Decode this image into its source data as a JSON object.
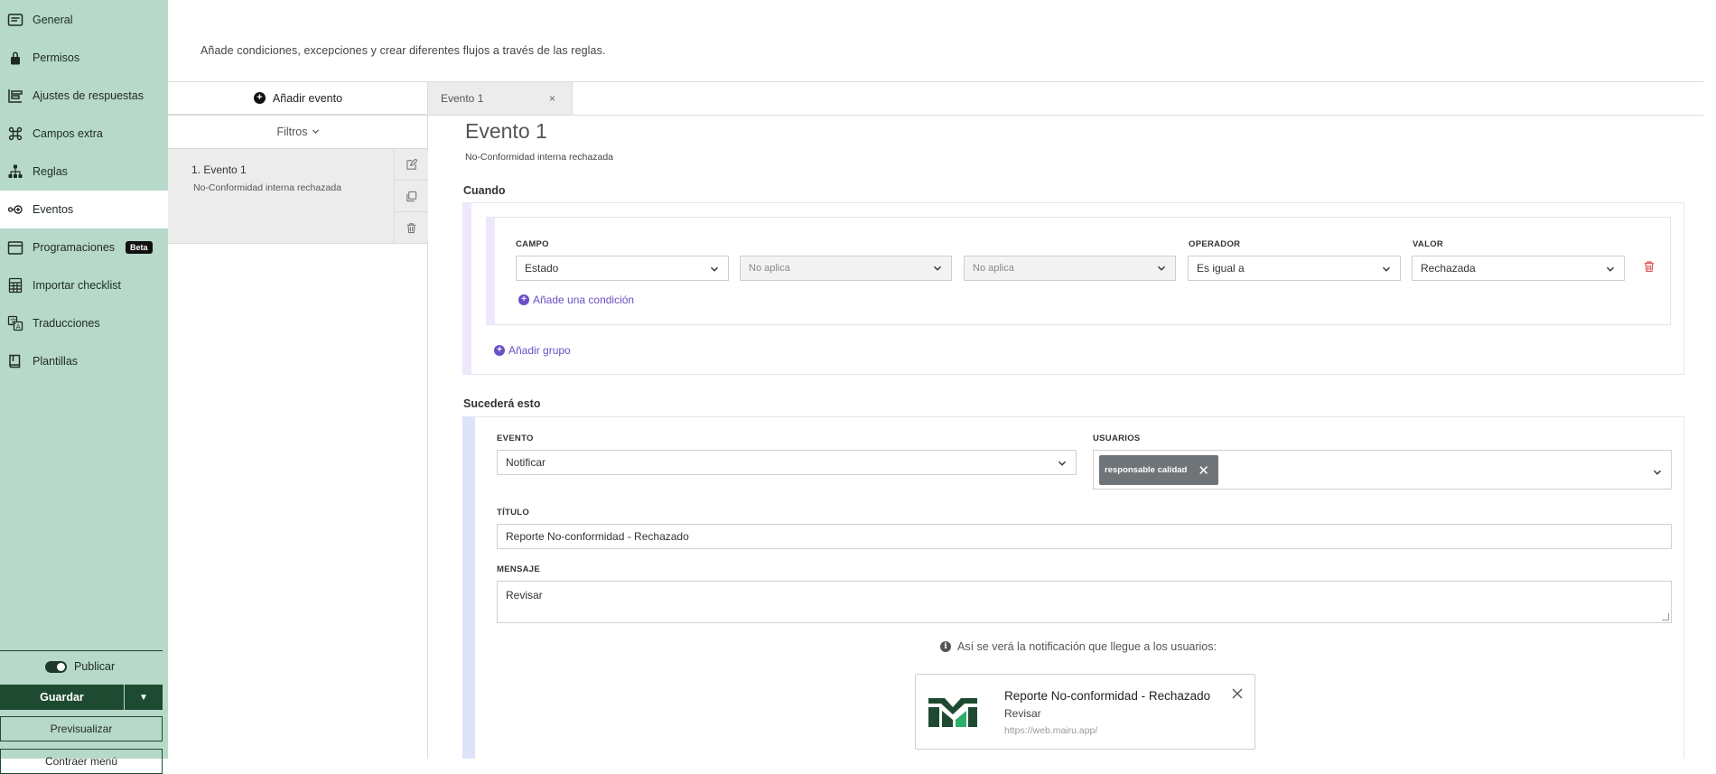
{
  "sidebar": {
    "items": [
      {
        "label": "General",
        "icon": "list-icon"
      },
      {
        "label": "Permisos",
        "icon": "lock-icon"
      },
      {
        "label": "Ajustes de respuestas",
        "icon": "sliders-icon"
      },
      {
        "label": "Campos extra",
        "icon": "command-icon"
      },
      {
        "label": "Reglas",
        "icon": "hierarchy-icon"
      },
      {
        "label": "Eventos",
        "icon": "event-icon",
        "active": true
      },
      {
        "label": "Programaciones",
        "icon": "calendar-icon",
        "badge": "Beta"
      },
      {
        "label": "Importar checklist",
        "icon": "spreadsheet-icon"
      },
      {
        "label": "Traducciones",
        "icon": "translate-icon"
      },
      {
        "label": "Plantillas",
        "icon": "book-icon"
      }
    ],
    "publish_label": "Publicar",
    "save_label": "Guardar",
    "preview_label": "Previsualizar",
    "collapse_label": "Contraer menú"
  },
  "header": {
    "description": "Añade condiciones, excepciones y crear diferentes flujos a través de las reglas."
  },
  "events_panel": {
    "add_event_label": "Añadir evento",
    "filters_label": "Filtros",
    "events": [
      {
        "title": "1. Evento 1",
        "subtitle": "No-Conformidad interna rechazada"
      }
    ]
  },
  "tabs": [
    {
      "label": "Evento 1",
      "close": "×"
    }
  ],
  "editor": {
    "title": "Evento 1",
    "subtitle": "No-Conformidad interna rechazada",
    "when": {
      "section_label": "Cuando",
      "campo_label": "CAMPO",
      "operador_label": "OPERADOR",
      "valor_label": "VALOR",
      "campo_value": "Estado",
      "sub1_value": "No aplica",
      "sub2_value": "No aplica",
      "operador_value": "Es igual a",
      "valor_value": "Rechazada",
      "add_condition_label": "Añade una condición",
      "add_group_label": "Añadir grupo"
    },
    "then": {
      "section_label": "Sucederá esto",
      "evento_label": "EVENTO",
      "evento_value": "Notificar",
      "usuarios_label": "USUARIOS",
      "users": [
        "responsable calidad"
      ],
      "titulo_label": "TÍTULO",
      "titulo_value": "Reporte No-conformidad - Rechazado",
      "mensaje_label": "MENSAJE",
      "mensaje_value": "Revisar",
      "preview_note": "Así se verá la notificación que llegue a los usuarios:"
    },
    "notification_preview": {
      "title": "Reporte No-conformidad - Rechazado",
      "body": "Revisar",
      "url": "https://web.mairu.app/"
    }
  },
  "colors": {
    "sidebar_bg": "#b6d9c9",
    "primary_dark": "#1e4a32",
    "accent_purple": "#6a4fc6",
    "danger": "#e05555"
  }
}
